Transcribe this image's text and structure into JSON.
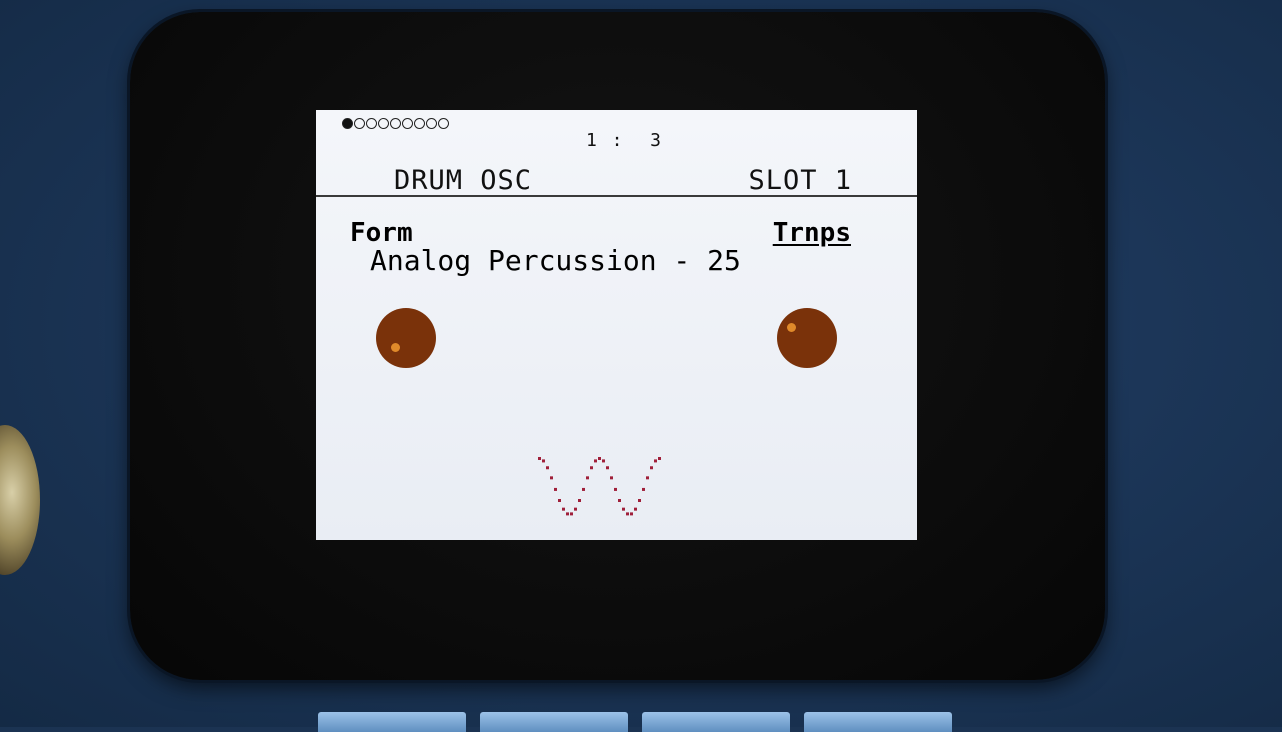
{
  "header": {
    "page_dots": [
      true,
      false,
      false,
      false,
      false,
      false,
      false,
      false,
      false
    ],
    "page_indicator": "1 :  3",
    "module_name": "DRUM OSC",
    "slot_name": "SLOT 1"
  },
  "params": {
    "left_label": "Form",
    "right_label": "Trnps",
    "value_line": "Analog Percussion - 25"
  },
  "knobs": {
    "left_icon": "knob-icon",
    "right_icon": "knob-icon"
  },
  "waveform": {
    "icon": "waveform-icon",
    "color": "#a0203a"
  },
  "colors": {
    "screen_bg": "#eef1f6",
    "knob": "#7a320a",
    "knob_marker": "#e08a2a"
  }
}
